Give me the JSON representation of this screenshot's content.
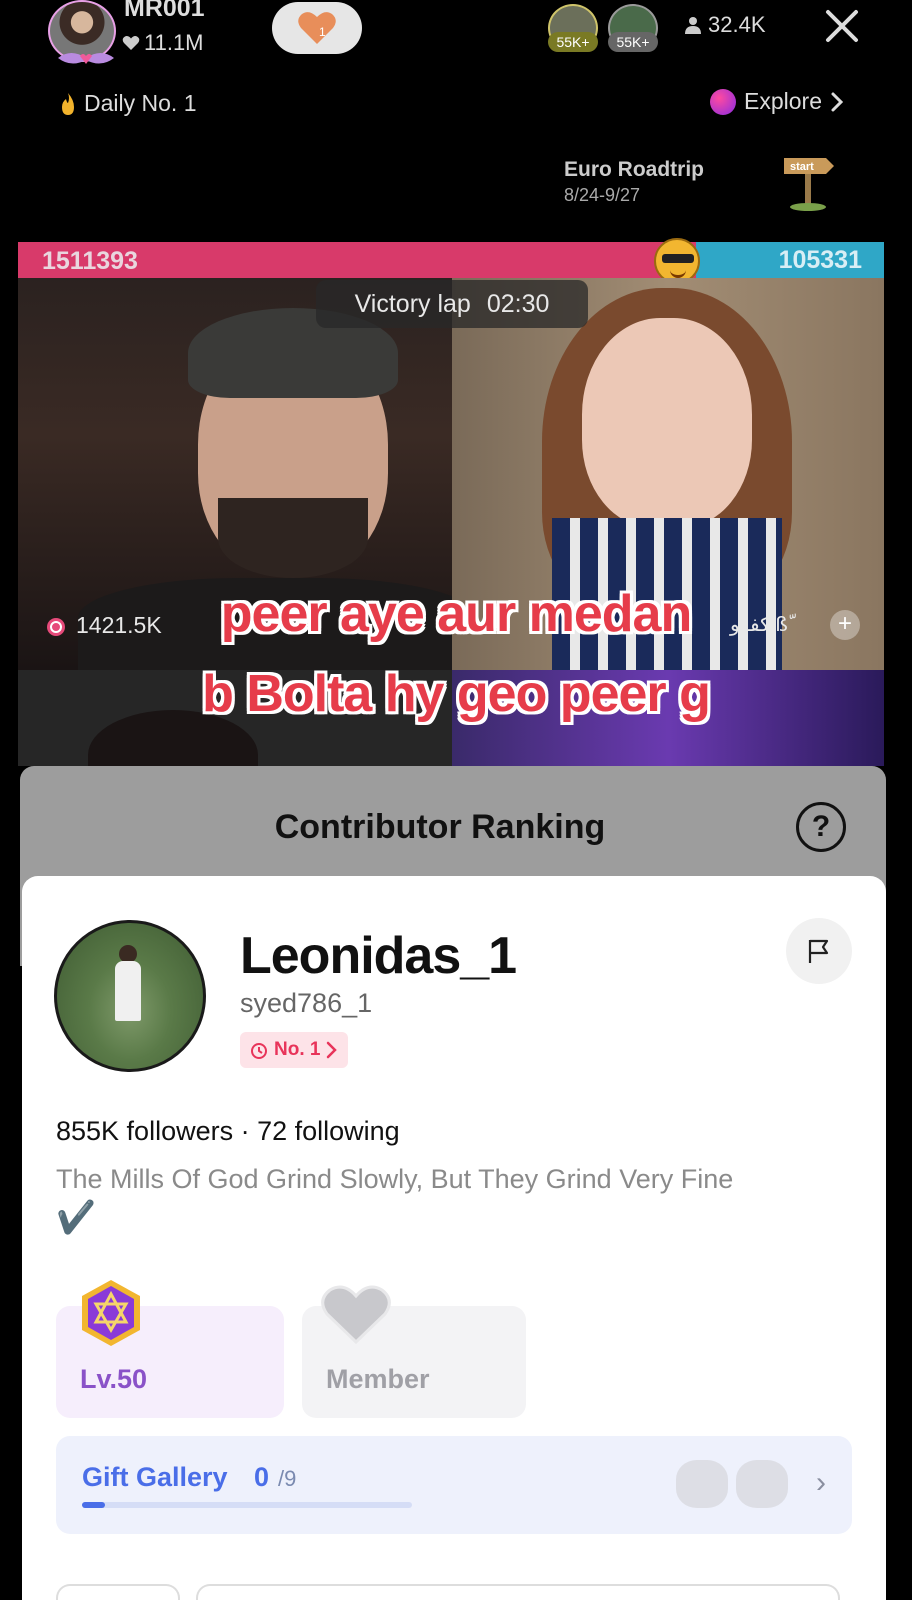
{
  "host": {
    "name": "MR001",
    "likes": "11.1M"
  },
  "top_viewers": [
    {
      "badge": "55K+"
    },
    {
      "badge": "55K+"
    }
  ],
  "viewer_count": "32.4K",
  "daily_rank": "Daily No. 1",
  "explore_label": "Explore",
  "event": {
    "title": "Euro Roadtrip",
    "dates": "8/24-9/27"
  },
  "battle": {
    "left_score": "1511393",
    "right_score": "105331",
    "status": "Victory lap",
    "timer": "02:30",
    "left_gift_score": "1421.5K",
    "right_user_fragment": "كفوو.ßّ"
  },
  "caption": {
    "line1": "peer aye aur medan",
    "line2": "b Bolta hy geo peer g"
  },
  "ranking": {
    "title": "Contributor Ranking",
    "help": "?"
  },
  "profile": {
    "display_name": "Leonidas_1",
    "handle": "syed786_1",
    "rank_badge": "No. 1",
    "follow_stats": "855K followers · 72 following",
    "bio": "The Mills Of God Grind Slowly, But They Grind Very Fine",
    "bio_emoji": "✔️",
    "level_label": "Lv.50",
    "member_label": "Member",
    "gift_gallery": {
      "label": "Gift Gallery",
      "collected": "0",
      "total": "/9",
      "progress": 0.07
    }
  },
  "colors": {
    "pk_left": "#d83a6a",
    "pk_right": "#2fa7c7",
    "caption": "#e63c4a",
    "gallery_accent": "#4a6ee8",
    "rank_accent": "#e8345a"
  }
}
